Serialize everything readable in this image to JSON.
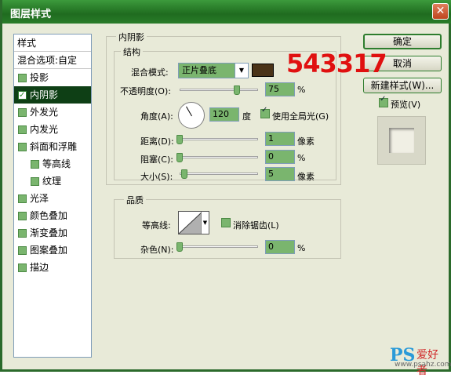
{
  "window": {
    "title": "图层样式",
    "close": "✕"
  },
  "styles_list": {
    "header": "样式",
    "blend": "混合选项:自定",
    "items": [
      {
        "label": "投影",
        "checked": false,
        "indent": false
      },
      {
        "label": "内阴影",
        "checked": true,
        "indent": false,
        "selected": true
      },
      {
        "label": "外发光",
        "checked": false,
        "indent": false
      },
      {
        "label": "内发光",
        "checked": false,
        "indent": false
      },
      {
        "label": "斜面和浮雕",
        "checked": false,
        "indent": false
      },
      {
        "label": "等高线",
        "checked": false,
        "indent": true
      },
      {
        "label": "纹理",
        "checked": false,
        "indent": true
      },
      {
        "label": "光泽",
        "checked": false,
        "indent": false
      },
      {
        "label": "颜色叠加",
        "checked": false,
        "indent": false
      },
      {
        "label": "渐变叠加",
        "checked": false,
        "indent": false
      },
      {
        "label": "图案叠加",
        "checked": false,
        "indent": false
      },
      {
        "label": "描边",
        "checked": false,
        "indent": false
      }
    ]
  },
  "inner_shadow": {
    "section_title": "内阴影",
    "structure": {
      "title": "结构",
      "blend_mode_label": "混合模式:",
      "blend_mode_value": "正片叠底",
      "color": "#4a3318",
      "opacity_label": "不透明度(O):",
      "opacity_value": "75",
      "opacity_unit": "%",
      "opacity_level": 0.75,
      "angle_label": "角度(A):",
      "angle_value": "120",
      "angle_unit": "度",
      "global_light_label": "使用全局光(G)",
      "global_light_checked": true,
      "distance_label": "距离(D):",
      "distance_value": "1",
      "distance_unit": "像素",
      "choke_label": "阻塞(C):",
      "choke_value": "0",
      "choke_unit": "%",
      "size_label": "大小(S):",
      "size_value": "5",
      "size_unit": "像素"
    },
    "quality": {
      "title": "品质",
      "contour_label": "等高线:",
      "antialias_label": "消除锯齿(L)",
      "antialias_checked": false,
      "noise_label": "杂色(N):",
      "noise_value": "0",
      "noise_unit": "%"
    }
  },
  "buttons": {
    "ok": "确定",
    "cancel": "取消",
    "new_style": "新建样式(W)...",
    "preview_label": "预览(V)",
    "preview_checked": true
  },
  "overlay": {
    "number": "543317",
    "ps_logo": "PS",
    "ps_cn": "爱好者",
    "ps_url": "www.psahz.com"
  }
}
